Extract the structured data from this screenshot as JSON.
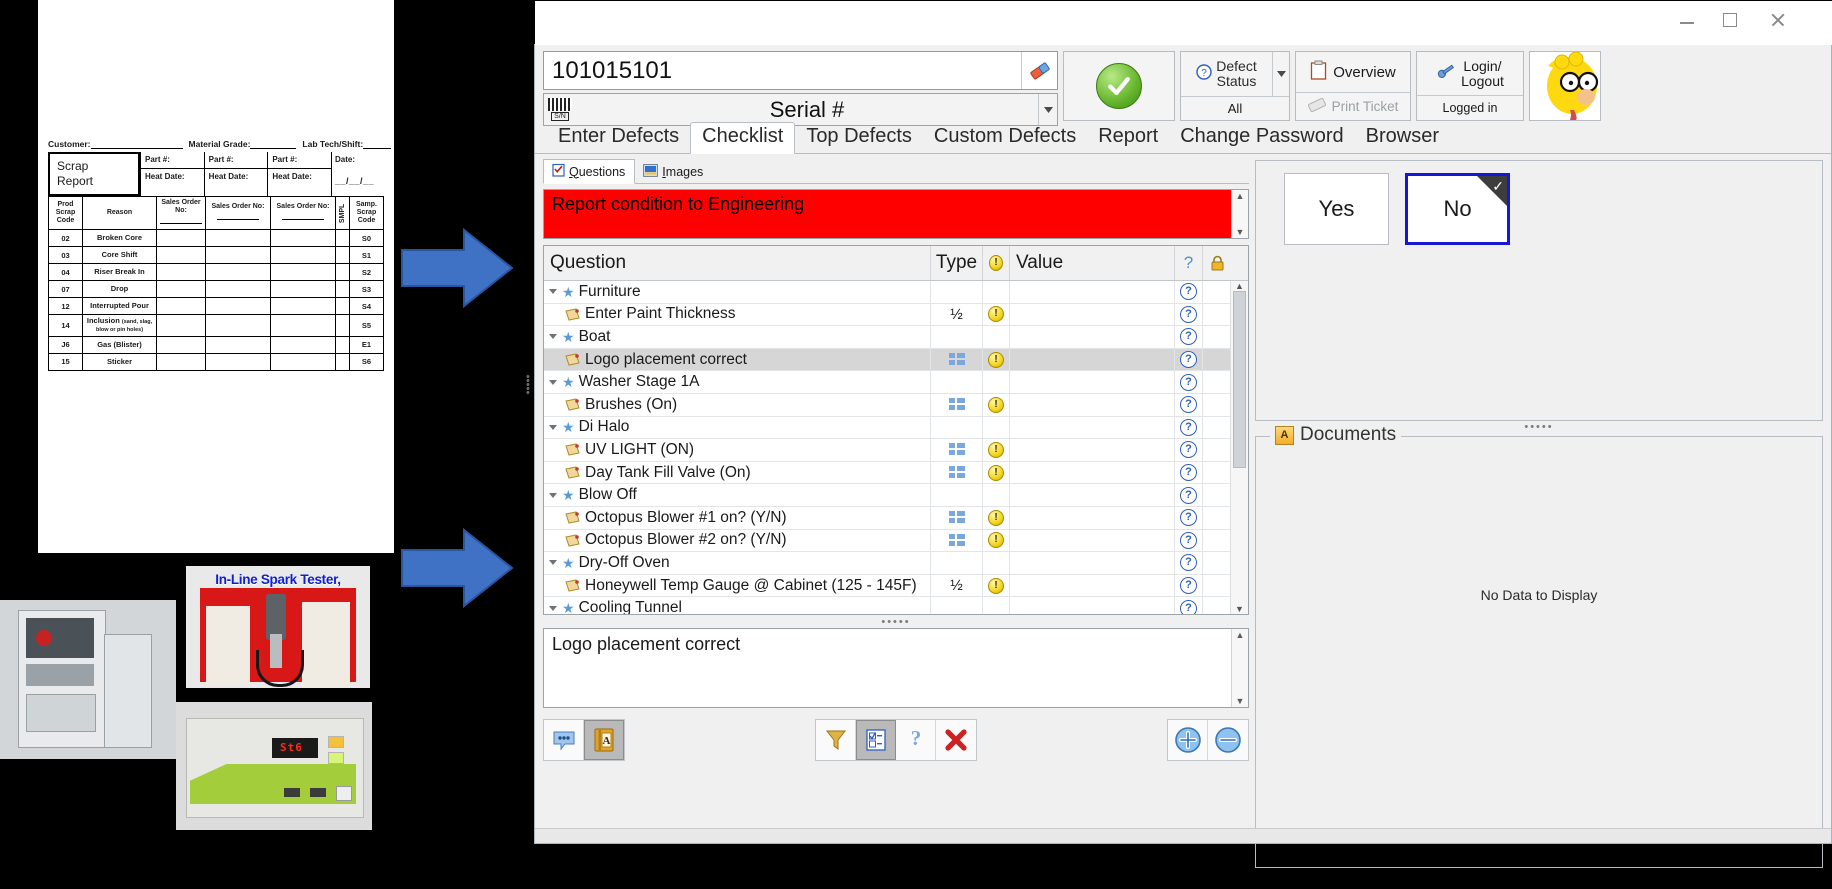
{
  "left_collage": {
    "scrap_report": {
      "top_fields": [
        {
          "label": "Customer:"
        },
        {
          "label": "Material Grade:"
        },
        {
          "label": "Lab Tech/Shift:"
        }
      ],
      "title_line1": "Scrap",
      "title_line2": "Report",
      "part_columns": [
        {
          "part": "Part #:",
          "heat": "Heat Date:"
        },
        {
          "part": "Part #:",
          "heat": "Heat Date:"
        },
        {
          "part": "Part #:",
          "heat": "Heat Date:"
        }
      ],
      "date_label": "Date:",
      "date_blanks": "__/__/__",
      "table_headers": {
        "code": "Prod Scrap Code",
        "reason": "Reason",
        "order1": "Sales Order No:",
        "order2": "Sales Order No:",
        "order3": "Sales Order No:",
        "sampl": "SMPL",
        "samp_code": "Samp. Scrap Code"
      },
      "rows": [
        {
          "code": "02",
          "reason": "Broken Core",
          "sub": "",
          "samp": "S0"
        },
        {
          "code": "03",
          "reason": "Core Shift",
          "sub": "",
          "samp": "S1"
        },
        {
          "code": "04",
          "reason": "Riser Break In",
          "sub": "",
          "samp": "S2"
        },
        {
          "code": "07",
          "reason": "Drop",
          "sub": "",
          "samp": "S3"
        },
        {
          "code": "12",
          "reason": "Interrupted Pour",
          "sub": "",
          "samp": "S4"
        },
        {
          "code": "14",
          "reason": "Inclusion",
          "sub": "(sand, slag, blow or pin holes)",
          "samp": "S5"
        },
        {
          "code": "J6",
          "reason": "Gas (Blister)",
          "sub": "",
          "samp": "E1"
        },
        {
          "code": "15",
          "reason": "Sticker",
          "sub": "",
          "samp": "S6"
        }
      ]
    },
    "photos": {
      "spark_tester_caption": "In-Line Spark Tester,",
      "tester_display": "St6"
    }
  },
  "header": {
    "serial_value": "101015101",
    "serial_placeholder": "Serial #",
    "serial_combo_label": "Serial #",
    "ok_icon": "green-check-icon",
    "defect_status_line1": "Defect",
    "defect_status_line2": "Status",
    "defect_status_filter": "All",
    "overview_label": "Overview",
    "print_ticket_label": "Print Ticket",
    "login_line1": "Login/",
    "login_line2": "Logout",
    "logged_in_label": "Logged in"
  },
  "main_tabs": [
    {
      "label": "Enter Defects",
      "active": false
    },
    {
      "label": "Checklist",
      "active": true
    },
    {
      "label": "Top Defects",
      "active": false
    },
    {
      "label": "Custom Defects",
      "active": false
    },
    {
      "label": "Report",
      "active": false
    },
    {
      "label": "Change Password",
      "active": false
    },
    {
      "label": "Browser",
      "active": false
    }
  ],
  "sub_tabs": [
    {
      "label": "Questions",
      "active": true,
      "icon": "questions-clipboard-icon"
    },
    {
      "label": "Images",
      "active": false,
      "icon": "images-picture-icon"
    }
  ],
  "banner": {
    "message": "Report condition to Engineering",
    "background": "#ff0000"
  },
  "grid": {
    "columns": [
      {
        "key": "question",
        "label": "Question"
      },
      {
        "key": "type",
        "label": "Type"
      },
      {
        "key": "warn",
        "label": "!"
      },
      {
        "key": "value",
        "label": "Value"
      },
      {
        "key": "help",
        "label": "?"
      },
      {
        "key": "lock",
        "label": "lock"
      }
    ],
    "rows": [
      {
        "kind": "group",
        "label": "Furniture",
        "type": "",
        "warn": false,
        "value": "",
        "help": true,
        "selected": false
      },
      {
        "kind": "item",
        "label": "Enter Paint Thickness",
        "type": "half",
        "warn": true,
        "value": "",
        "help": true,
        "selected": false
      },
      {
        "kind": "group",
        "label": "Boat",
        "type": "",
        "warn": false,
        "value": "",
        "help": true,
        "selected": false
      },
      {
        "kind": "item",
        "label": "Logo placement correct",
        "type": "list",
        "warn": true,
        "value": "",
        "help": true,
        "selected": true
      },
      {
        "kind": "group",
        "label": "Washer Stage 1A",
        "type": "",
        "warn": false,
        "value": "",
        "help": true,
        "selected": false
      },
      {
        "kind": "item",
        "label": "Brushes (On)",
        "type": "list",
        "warn": true,
        "value": "",
        "help": true,
        "selected": false
      },
      {
        "kind": "group",
        "label": "Di Halo",
        "type": "",
        "warn": false,
        "value": "",
        "help": true,
        "selected": false
      },
      {
        "kind": "item",
        "label": "UV LIGHT (ON)",
        "type": "list",
        "warn": true,
        "value": "",
        "help": true,
        "selected": false
      },
      {
        "kind": "item",
        "label": "Day Tank Fill Valve (On)",
        "type": "list",
        "warn": true,
        "value": "",
        "help": true,
        "selected": false
      },
      {
        "kind": "group",
        "label": "Blow Off",
        "type": "",
        "warn": false,
        "value": "",
        "help": true,
        "selected": false
      },
      {
        "kind": "item",
        "label": "Octopus Blower #1 on? (Y/N)",
        "type": "list",
        "warn": true,
        "value": "",
        "help": true,
        "selected": false
      },
      {
        "kind": "item",
        "label": "Octopus Blower #2 on? (Y/N)",
        "type": "list",
        "warn": true,
        "value": "",
        "help": true,
        "selected": false
      },
      {
        "kind": "group",
        "label": "Dry-Off Oven",
        "type": "",
        "warn": false,
        "value": "",
        "help": true,
        "selected": false
      },
      {
        "kind": "item",
        "label": "Honeywell Temp Gauge @ Cabinet (125 - 145F)",
        "type": "half",
        "warn": true,
        "value": "",
        "help": true,
        "selected": false
      },
      {
        "kind": "group",
        "label": "Cooling Tunnel",
        "type": "",
        "warn": false,
        "value": "",
        "help": true,
        "selected": false
      }
    ]
  },
  "memo": {
    "text": "Logo placement correct"
  },
  "bottom_toolbar": {
    "left": [
      {
        "name": "comment-bubble-icon",
        "pressed": false
      },
      {
        "name": "dictionary-book-icon",
        "pressed": true
      }
    ],
    "center": [
      {
        "name": "filter-funnel-icon",
        "pressed": false
      },
      {
        "name": "checklist-edit-icon",
        "pressed": true
      },
      {
        "name": "question-mark-icon",
        "pressed": false
      },
      {
        "name": "red-x-delete-icon",
        "pressed": false
      }
    ],
    "right": [
      {
        "name": "zoom-in-plus-icon",
        "pressed": false
      },
      {
        "name": "zoom-out-minus-icon",
        "pressed": false
      }
    ]
  },
  "answer_panel": {
    "buttons": [
      {
        "label": "Yes",
        "selected": false
      },
      {
        "label": "No",
        "selected": true
      }
    ]
  },
  "documents_panel": {
    "title": "Documents",
    "empty_text": "No Data to Display"
  },
  "colors": {
    "banner_red": "#ff0000",
    "selection_blue": "#1616d8",
    "row_selected": "#d6d6d6",
    "star_blue": "#5b9bd5",
    "warn_yellow": "#f4d51a",
    "arrow_blue": "#2f6fd0"
  }
}
